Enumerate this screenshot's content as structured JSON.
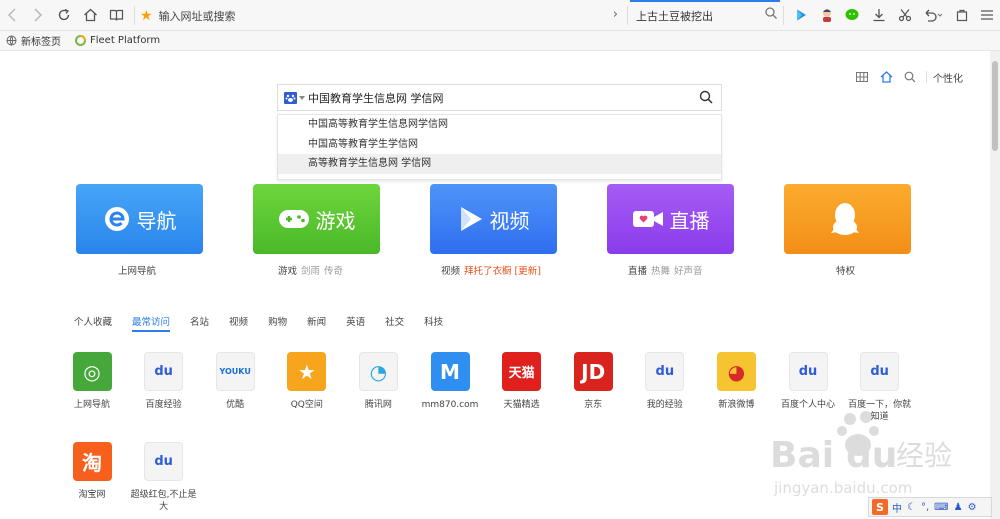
{
  "toolbar": {
    "address_text": "输入网址或搜索",
    "search_text": "上古土豆被挖出"
  },
  "bookmarks": [
    {
      "label": "新标签页",
      "icon": "globe-icon"
    },
    {
      "label": "Fleet Platform",
      "icon": "fleet-logo-icon"
    }
  ],
  "top_right": {
    "personalize_label": "个性化"
  },
  "search": {
    "query": "中国教育学生信息网 学信网",
    "engine_icon": "baidu-paw-icon",
    "suggestions": [
      "中国高等教育学生信息网学信网",
      "中国高等教育学生学信网",
      "高等教育学生信息网 学信网"
    ]
  },
  "categories": [
    {
      "title": "导航",
      "icon": "e-logo-icon",
      "color": "#2f8ff0",
      "sub": "上网导航",
      "sub_extra": []
    },
    {
      "title": "游戏",
      "icon": "gamepad-icon",
      "color": "#5bc632",
      "sub": "游戏",
      "sub_extra": [
        "剑雨",
        "传奇"
      ]
    },
    {
      "title": "视频",
      "icon": "play-icon",
      "color": "#3d82f5",
      "sub": "视频",
      "sub_extra": [
        "拜托了衣橱 [更新]"
      ]
    },
    {
      "title": "直播",
      "icon": "camera-icon",
      "color": "#9a4cf0",
      "sub": "直播",
      "sub_extra": [
        "热舞",
        "好声音"
      ]
    },
    {
      "title": "",
      "icon": "qq-penguin-icon",
      "color": "#f6981f",
      "sub": "特权",
      "sub_extra": []
    }
  ],
  "tabs": [
    "个人收藏",
    "最常访问",
    "名站",
    "视频",
    "购物",
    "新闻",
    "英语",
    "社交",
    "科技"
  ],
  "active_tab": "最常访问",
  "sites": [
    {
      "label": "上网导航",
      "icon": "compass-icon",
      "bg": "#46a83a",
      "glyph": "◎"
    },
    {
      "label": "百度经验",
      "icon": "baidu-paw-icon",
      "bg": "#f4f4f4",
      "glyph": "du"
    },
    {
      "label": "优酷",
      "icon": "youku-logo-icon",
      "bg": "#f4f4f4",
      "glyph": "YOUKU"
    },
    {
      "label": "QQ空间",
      "icon": "qzone-star-icon",
      "bg": "#f7a51c",
      "glyph": "★"
    },
    {
      "label": "腾讯网",
      "icon": "tencent-logo-icon",
      "bg": "#f4f4f4",
      "glyph": "◔"
    },
    {
      "label": "mm870.com",
      "icon": "m-letter-icon",
      "bg": "#2f8ff0",
      "glyph": "M"
    },
    {
      "label": "天猫精选",
      "icon": "tmall-logo-icon",
      "bg": "#e0201c",
      "glyph": "天猫"
    },
    {
      "label": "京东",
      "icon": "jd-logo-icon",
      "bg": "#d8241c",
      "glyph": "JD"
    },
    {
      "label": "我的经验",
      "icon": "baidu-paw-icon",
      "bg": "#f4f4f4",
      "glyph": "du"
    },
    {
      "label": "新浪微博",
      "icon": "weibo-logo-icon",
      "bg": "#f6c331",
      "glyph": "◕"
    },
    {
      "label": "百度个人中心",
      "icon": "baidu-paw-icon",
      "bg": "#f4f4f4",
      "glyph": "du"
    },
    {
      "label": "百度一下，你就知道",
      "icon": "baidu-paw-icon",
      "bg": "#f4f4f4",
      "glyph": "du"
    },
    {
      "label": "淘宝网",
      "icon": "taobao-logo-icon",
      "bg": "#f6601c",
      "glyph": "淘"
    },
    {
      "label": "超级红包,不止是大",
      "icon": "baidu-paw-icon",
      "bg": "#f4f4f4",
      "glyph": "du"
    }
  ],
  "watermark": {
    "brand": "Bai du 经验",
    "url": "jingyan.baidu.com"
  },
  "ime": {
    "mode": "中"
  }
}
